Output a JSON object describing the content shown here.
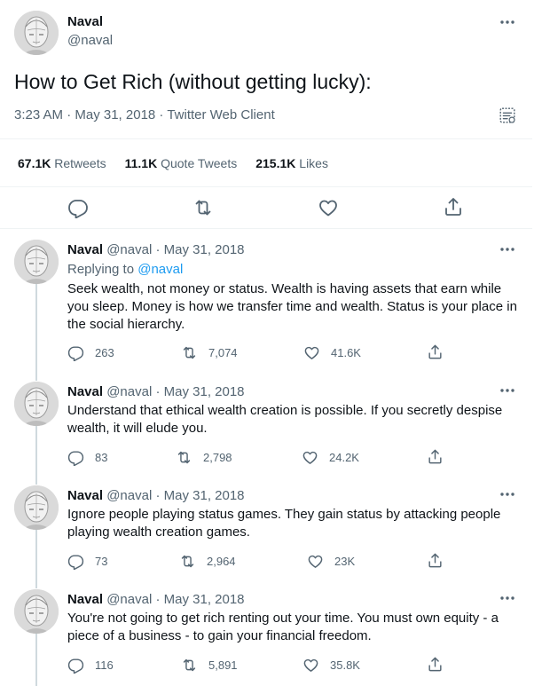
{
  "main_tweet": {
    "author_name": "Naval",
    "author_handle": "@naval",
    "text": "How to Get Rich (without getting lucky):",
    "timestamp": "3:23 AM · May 31, 2018 · Twitter Web Client",
    "stats": {
      "retweets_count": "67.1K",
      "retweets_label": "Retweets",
      "quotes_count": "11.1K",
      "quotes_label": "Quote Tweets",
      "likes_count": "215.1K",
      "likes_label": "Likes"
    }
  },
  "replies": [
    {
      "author_name": "Naval",
      "author_handle": "@naval",
      "date": "· May 31, 2018",
      "replying_prefix": "Replying to",
      "replying_handle": "@naval",
      "text": "Seek wealth, not money or status. Wealth is having assets that earn while you sleep. Money is how we transfer time and wealth. Status is your place in the social hierarchy.",
      "replies": "263",
      "retweets": "7,074",
      "likes": "41.6K"
    },
    {
      "author_name": "Naval",
      "author_handle": "@naval",
      "date": "· May 31, 2018",
      "text": "Understand that ethical wealth creation is possible. If you secretly despise wealth, it will elude you.",
      "replies": "83",
      "retweets": "2,798",
      "likes": "24.2K"
    },
    {
      "author_name": "Naval",
      "author_handle": "@naval",
      "date": "· May 31, 2018",
      "text": "Ignore people playing status games. They gain status by attacking people playing wealth creation games.",
      "replies": "73",
      "retweets": "2,964",
      "likes": "23K"
    },
    {
      "author_name": "Naval",
      "author_handle": "@naval",
      "date": "· May 31, 2018",
      "text": "You're not going to get rich renting out your time. You must own equity - a piece of a business - to gain your financial freedom.",
      "replies": "116",
      "retweets": "5,891",
      "likes": "35.8K"
    }
  ],
  "icons": {
    "more": "more-horizontal-icon",
    "analytics": "analytics-icon",
    "reply": "reply-icon",
    "retweet": "retweet-icon",
    "like": "heart-icon",
    "share": "share-icon"
  },
  "colors": {
    "text": "#0f1419",
    "secondary": "#536471",
    "link": "#1d9bf0",
    "divider": "#eff3f4",
    "thread_line": "#cfd9de"
  }
}
